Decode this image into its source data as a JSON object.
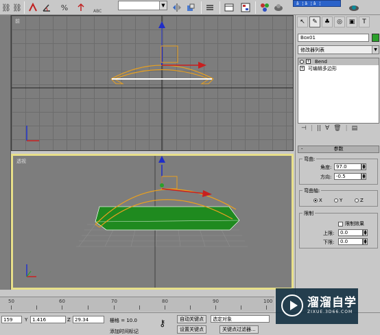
{
  "toolbar": {
    "ref_coord_value": "",
    "abc_label": "ABC",
    "named_selection": "â¦ â¦ â¦"
  },
  "viewports": {
    "front_label": "前",
    "persp_label": "透视"
  },
  "command_panel": {
    "object_name": "Box01",
    "object_color": "#2aa02a",
    "modifier_list": "修改器列表",
    "stack": [
      {
        "label": "Bend",
        "type": "modifier",
        "selected": true
      },
      {
        "label": "可编辑多边形",
        "type": "base",
        "selected": false
      }
    ],
    "rollout_title": "参数",
    "rollout_minus": "-",
    "bend_group": "弯曲:",
    "angle_label": "角度:",
    "angle_value": "97.0",
    "direction_label": "方向:",
    "direction_value": "-0.5",
    "axis_group": "弯曲轴:",
    "axes": [
      "X",
      "Y",
      "Z"
    ],
    "selected_axis": "X",
    "limits_group": "限制",
    "limit_effect_label": "限制效果",
    "upper_label": "上限:",
    "upper_value": "0.0",
    "lower_label": "下限:",
    "lower_value": "0.0"
  },
  "timeline": {
    "ticks": [
      "50",
      "60",
      "70",
      "80",
      "90",
      "100"
    ]
  },
  "status": {
    "x_value": "159",
    "y_label": "Y",
    "y_value": "1.416",
    "z_label": "Z",
    "z_value": "29.34",
    "grid_label": "栅格 = 10.0",
    "auto_key": "自动关键点",
    "selected_object": "选定对象",
    "set_key": "设置关键点",
    "key_filters": "关键点过滤器...",
    "add_time_tag": "添加时间标记"
  },
  "watermark": {
    "title": "溜溜自学",
    "subtitle": "ZIXUE.3D66.COM"
  },
  "colors": {
    "viewport_bg": "#7d7d7d",
    "active_viewport_border": "#e8e08a",
    "gizmo_orange": "#e8a020",
    "object_green": "#1f8a1f"
  }
}
